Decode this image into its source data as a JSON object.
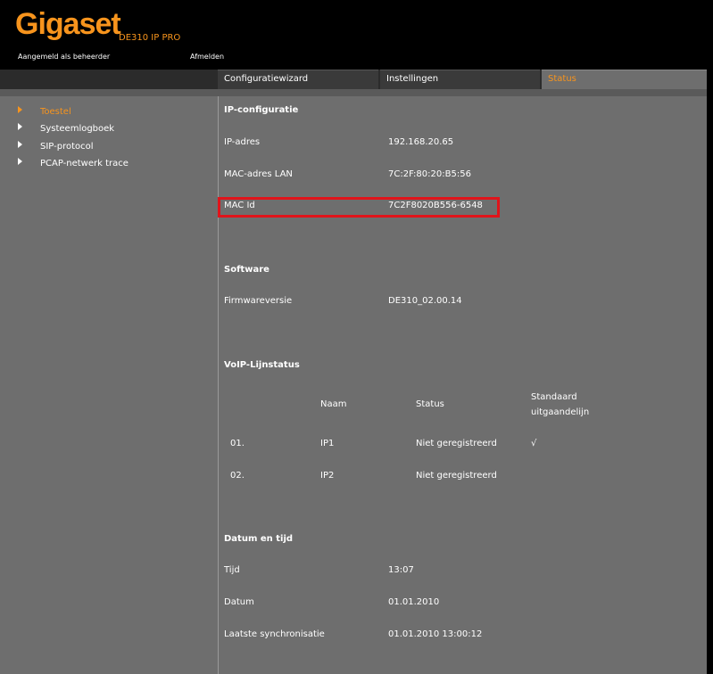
{
  "header": {
    "logo": "Gigaset",
    "model": "DE310 IP PRO",
    "logged_in_as": "Aangemeld als beheerder",
    "logout": "Afmelden"
  },
  "tabs": [
    {
      "label": "Configuratiewizard"
    },
    {
      "label": "Instellingen"
    },
    {
      "label": "Status",
      "active": true
    }
  ],
  "sidebar": {
    "items": [
      {
        "label": "Toestel",
        "active": true
      },
      {
        "label": "Systeemlogboek"
      },
      {
        "label": "SIP-protocol"
      },
      {
        "label": "PCAP-netwerk trace"
      }
    ]
  },
  "ip_config": {
    "heading": "IP-configuratie",
    "ip_label": "IP-adres",
    "ip_value": "192.168.20.65",
    "mac_lan_label": "MAC-adres LAN",
    "mac_lan_value": "7C:2F:80:20:B5:56",
    "mac_id_label": "MAC Id",
    "mac_id_value": "7C2F8020B556-6548"
  },
  "software": {
    "heading": "Software",
    "firmware_label": "Firmwareversie",
    "firmware_value": "DE310_02.00.14"
  },
  "voip": {
    "heading": "VoIP-Lijnstatus",
    "columns": {
      "name": "Naam",
      "status": "Status",
      "default_line_1": "Standaard",
      "default_line_2": "uitgaandelijn"
    },
    "rows": [
      {
        "index": "01.",
        "name": "IP1",
        "status": "Niet geregistreerd",
        "default": "√"
      },
      {
        "index": "02.",
        "name": "IP2",
        "status": "Niet geregistreerd",
        "default": ""
      }
    ]
  },
  "datetime": {
    "heading": "Datum en tijd",
    "time_label": "Tijd",
    "time_value": "13:07",
    "date_label": "Datum",
    "date_value": "01.01.2010",
    "sync_label": "Laatste synchronisatie",
    "sync_value": "01.01.2010 13:00:12"
  },
  "colors": {
    "accent": "#f7941d",
    "highlight": "#e0141b",
    "panel": "#6e6e6e"
  }
}
